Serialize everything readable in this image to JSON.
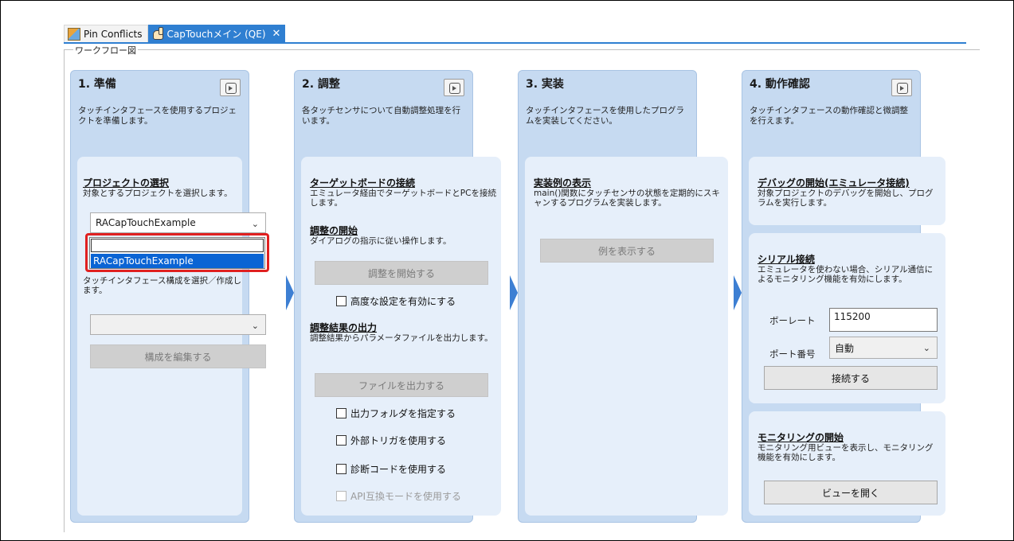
{
  "tabs": [
    {
      "label": "Pin Conflicts",
      "icon": "pin-conflicts-icon"
    },
    {
      "label": "CapTouchメイン (QE)",
      "icon": "hand-touch-icon",
      "close": "✕"
    }
  ],
  "workflow_label": "ワークフロー図",
  "columns": {
    "prep": {
      "title": "1. 準備",
      "desc": "タッチインタフェースを使用するプロジェクトを準備します。",
      "project": {
        "title": "プロジェクトの選択",
        "desc": "対象とするプロジェクトを選択します。",
        "selected": "RACapTouchExample",
        "dropdown_option": "RACapTouchExample"
      },
      "config": {
        "desc": "タッチインタフェース構成を選択／作成します。",
        "select_value": "",
        "edit_button": "構成を編集する"
      }
    },
    "tune": {
      "title": "2. 調整",
      "desc": "各タッチセンサについて自動調整処理を行います。",
      "board": {
        "title": "ターゲットボードの接続",
        "desc": "エミュレータ経由でターゲットボードとPCを接続します。"
      },
      "start": {
        "title": "調整の開始",
        "desc": "ダイアログの指示に従い操作します。",
        "button": "調整を開始する",
        "advanced": "高度な設定を有効にする"
      },
      "output": {
        "title": "調整結果の出力",
        "desc": "調整結果からパラメータファイルを出力します。",
        "button": "ファイルを出力する",
        "opt_folder": "出力フォルダを指定する",
        "opt_trigger": "外部トリガを使用する",
        "opt_diag": "診断コードを使用する",
        "opt_api": "API互換モードを使用する"
      }
    },
    "impl": {
      "title": "3. 実装",
      "desc": "タッチインタフェースを使用したプログラムを実装してください。",
      "example": {
        "title": "実装例の表示",
        "desc": "main()関数にタッチセンサの状態を定期的にスキャンするプログラムを実装します。",
        "button": "例を表示する"
      }
    },
    "verify": {
      "title": "4. 動作確認",
      "desc": "タッチインタフェースの動作確認と微調整を行えます。",
      "debug": {
        "title": "デバッグの開始(エミュレータ接続)",
        "desc": "対象プロジェクトのデバッグを開始し、プログラムを実行します。"
      },
      "serial": {
        "title": "シリアル接続",
        "desc": "エミュレータを使わない場合、シリアル通信によるモニタリング機能を有効にします。",
        "baud_label": "ボーレート",
        "baud_value": "115200",
        "port_label": "ポート番号",
        "port_value": "自動",
        "button": "接続する"
      },
      "monitor": {
        "title": "モニタリングの開始",
        "desc": "モニタリング用ビューを表示し、モニタリング機能を有効にします。",
        "button": "ビューを開く"
      }
    }
  }
}
